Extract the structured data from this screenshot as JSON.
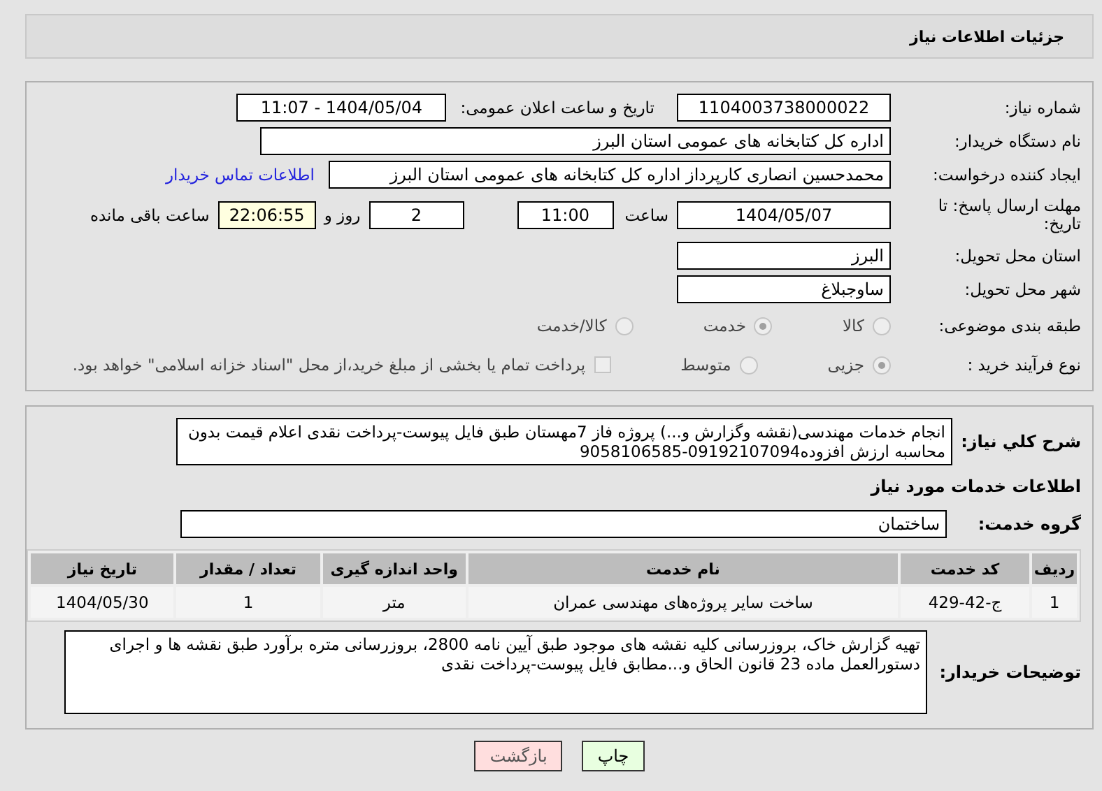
{
  "header": {
    "title": "جزئیات اطلاعات نیاز"
  },
  "need_number": {
    "label": "شماره نیاز:",
    "value": "1104003738000022"
  },
  "announce_date": {
    "label": "تاریخ و ساعت اعلان عمومی:",
    "value": "1404/05/04 - 11:07"
  },
  "buyer_org": {
    "label": "نام دستگاه خریدار:",
    "value": "اداره کل کتابخانه های عمومی استان البرز"
  },
  "creator": {
    "label": "ایجاد کننده درخواست:",
    "value": "محمدحسین انصاری کارپرداز اداره کل کتابخانه های عمومی استان البرز",
    "link": "اطلاعات تماس خریدار"
  },
  "deadline": {
    "label": "مهلت ارسال پاسخ: تا تاریخ:",
    "date": "1404/05/07",
    "time_label": "ساعت",
    "time": "11:00",
    "days": "2",
    "days_label": "روز و",
    "remaining": "22:06:55",
    "remaining_label": "ساعت باقی مانده"
  },
  "province": {
    "label": "استان محل تحویل:",
    "value": "البرز"
  },
  "city": {
    "label": "شهر محل تحویل:",
    "value": "ساوجبلاغ"
  },
  "category": {
    "label": "طبقه بندی موضوعی:",
    "options": [
      {
        "label": "کالا",
        "selected": false
      },
      {
        "label": "خدمت",
        "selected": true
      },
      {
        "label": "کالا/خدمت",
        "selected": false
      }
    ]
  },
  "process": {
    "label": "نوع فرآیند خرید :",
    "options": [
      {
        "label": "جزیی",
        "selected": true
      },
      {
        "label": "متوسط",
        "selected": false
      }
    ],
    "treasury": {
      "checked": false,
      "label": "پرداخت تمام یا بخشی از مبلغ خرید،از محل \"اسناد خزانه اسلامی\" خواهد بود."
    }
  },
  "description": {
    "label": "شرح کلي نياز:",
    "value": "انجام خدمات مهندسی(نقشه وگزارش و...) پروژه فاز 7مهستان طبق فایل پیوست-پرداخت نقدی اعلام قیمت بدون محاسبه ارزش افزوده09192107094-9058106585"
  },
  "services_heading": "اطلاعات خدمات مورد نیاز",
  "service_group": {
    "label": "گروه خدمت:",
    "value": "ساختمان"
  },
  "table": {
    "columns": [
      "ردیف",
      "کد خدمت",
      "نام خدمت",
      "واحد اندازه گیری",
      "تعداد / مقدار",
      "تاریخ نیاز"
    ],
    "rows": [
      [
        "1",
        "ج-42-429",
        "ساخت سایر پروژه‌های مهندسی عمران",
        "متر",
        "1",
        "1404/05/30"
      ]
    ]
  },
  "buyer_notes": {
    "label": "توضیحات خریدار:",
    "value": "تهیه گزارش خاک، بروزرسانی کلیه نقشه های موجود طبق آیین نامه 2800، بروزرسانی متره برآورد طبق نقشه ها و اجرای دستورالعمل ماده 23 قانون الحاق و...مطابق فایل پیوست-پرداخت نقدی"
  },
  "buttons": [
    {
      "kind": "print",
      "label": "چاپ"
    },
    {
      "kind": "back",
      "label": "بازگشت"
    }
  ]
}
